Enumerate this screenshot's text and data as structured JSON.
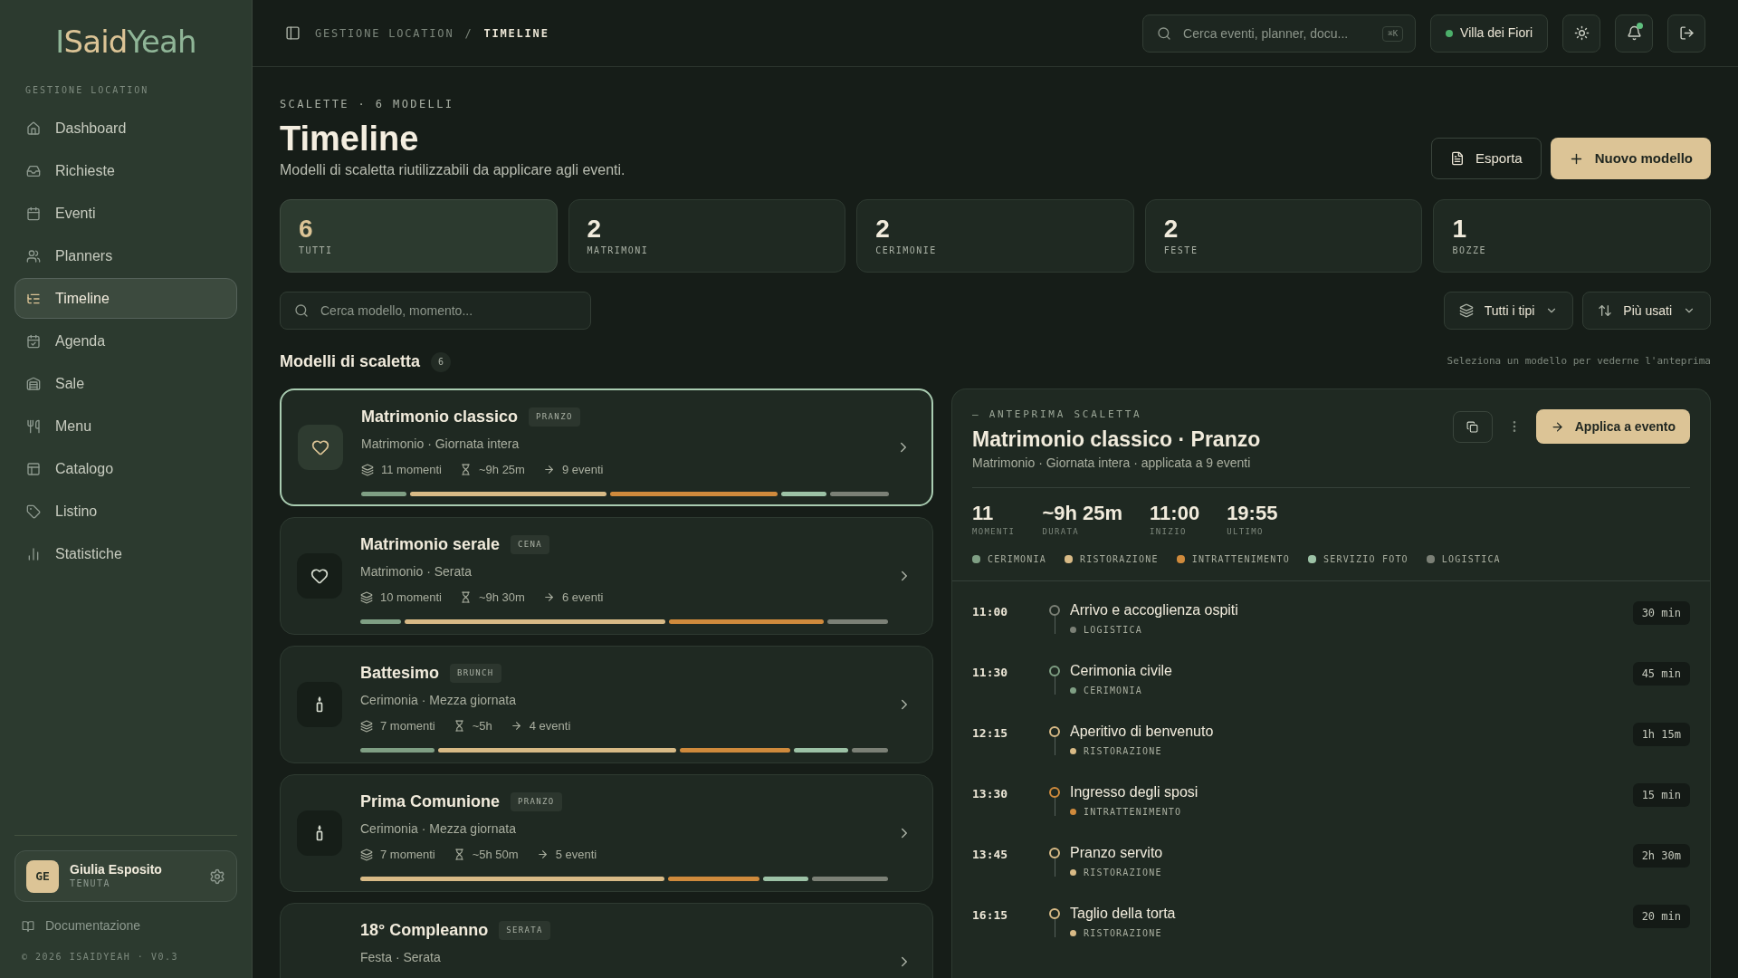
{
  "sidebar": {
    "logo": [
      "I",
      "Said",
      "Yeah"
    ],
    "section_label": "GESTIONE LOCATION",
    "items": [
      {
        "label": "Dashboard",
        "selected": false
      },
      {
        "label": "Richieste",
        "selected": false
      },
      {
        "label": "Eventi",
        "selected": false
      },
      {
        "label": "Planners",
        "selected": false
      },
      {
        "label": "Timeline",
        "selected": true
      },
      {
        "label": "Agenda",
        "selected": false
      },
      {
        "label": "Sale",
        "selected": false
      },
      {
        "label": "Menu",
        "selected": false
      },
      {
        "label": "Catalogo",
        "selected": false
      },
      {
        "label": "Listino",
        "selected": false
      },
      {
        "label": "Statistiche",
        "selected": false
      }
    ],
    "user": {
      "initials": "GE",
      "name": "Giulia Esposito",
      "role": "TENUTA"
    },
    "docs_link": "Documentazione",
    "footer": "© 2026 ISAIDYEAH · V0.3"
  },
  "topbar": {
    "breadcrumb": [
      "GESTIONE LOCATION",
      "/",
      "TIMELINE"
    ],
    "search": {
      "placeholder": "Cerca eventi, planner, docu...",
      "shortcut": "⌘K"
    },
    "location": "Villa dei Fiori",
    "notifications_unread": true
  },
  "header": {
    "eyebrow": "SCALETTE · 6 MODELLI",
    "title": "Timeline",
    "subtitle": "Modelli di scaletta riutilizzabili da applicare agli eventi.",
    "buttons": [
      "Esporta",
      "Nuovo modello"
    ]
  },
  "stats": [
    {
      "value": "6",
      "label": "TUTTI",
      "selected": true
    },
    {
      "value": "2",
      "label": "MATRIMONI",
      "selected": false
    },
    {
      "value": "2",
      "label": "CERIMONIE",
      "selected": false
    },
    {
      "value": "2",
      "label": "FESTE",
      "selected": false
    },
    {
      "value": "1",
      "label": "BOZZE",
      "selected": false
    }
  ],
  "filters": {
    "search": {
      "placeholder": "Cerca modello, momento..."
    },
    "type": "Tutti i tipi",
    "sort": "Più usati"
  },
  "list": {
    "title": "Modelli di scaletta",
    "count": "6",
    "hint": "Seleziona un modello per vederne l'anteprima"
  },
  "cards": [
    {
      "title": "Matrimonio classico",
      "tag": "PRANZO",
      "kind": "wedding",
      "subtitle": "Matrimonio · Giornata intera",
      "moments": "11 momenti",
      "duration": "~9h 25m",
      "events": "9 eventi",
      "selected": true,
      "segments": [
        {
          "color": "#7f9f84"
        },
        {
          "color": "#d8ba86"
        },
        {
          "color": "#cf8a3c"
        },
        {
          "color": "#9cc2a6"
        },
        {
          "color": "#7b8076"
        }
      ]
    },
    {
      "title": "Matrimonio serale",
      "tag": "CENA",
      "kind": "wedding",
      "subtitle": "Matrimonio · Serata",
      "moments": "10 momenti",
      "duration": "~9h 30m",
      "events": "6 eventi",
      "selected": false,
      "segments": [
        {
          "color": "#7f9f84"
        },
        {
          "color": "#d8ba86"
        },
        {
          "color": "#cf8a3c"
        },
        {
          "color": "#7b8076"
        }
      ]
    },
    {
      "title": "Battesimo",
      "tag": "BRUNCH",
      "kind": "ceremony",
      "subtitle": "Cerimonia · Mezza giornata",
      "moments": "7 momenti",
      "duration": "~5h",
      "events": "4 eventi",
      "selected": false,
      "segments": [
        {
          "color": "#7f9f84"
        },
        {
          "color": "#d8ba86"
        },
        {
          "color": "#cf8a3c"
        },
        {
          "color": "#9cc2a6"
        },
        {
          "color": "#7b8076"
        }
      ]
    },
    {
      "title": "Prima Comunione",
      "tag": "PRANZO",
      "kind": "ceremony",
      "subtitle": "Cerimonia · Mezza giornata",
      "moments": "7 momenti",
      "duration": "~5h 50m",
      "events": "5 eventi",
      "selected": false,
      "segments": [
        {
          "color": "#d8ba86"
        },
        {
          "color": "#cf8a3c"
        },
        {
          "color": "#9cc2a6"
        },
        {
          "color": "#7b8076"
        }
      ]
    },
    {
      "title": "18° Compleanno",
      "tag": "SERATA",
      "subtitle": "Festa · Serata",
      "selected": false
    }
  ],
  "preview": {
    "eyebrow": "— ANTEPRIMA SCALETTA",
    "title": "Matrimonio classico · Pranzo",
    "subtitle": "Matrimonio · Giornata intera · applicata a 9 eventi",
    "apply": "Applica a evento",
    "stats": [
      {
        "value": "11",
        "label": "MOMENTI"
      },
      {
        "value": "~9h 25m",
        "label": "DURATA"
      },
      {
        "value": "11:00",
        "label": "INIZIO"
      },
      {
        "value": "19:55",
        "label": "ULTIMO"
      }
    ],
    "legend": [
      {
        "label": "CERIMONIA",
        "color": "#7f9f84"
      },
      {
        "label": "RISTORAZIONE",
        "color": "#d8ba86"
      },
      {
        "label": "INTRATTENIMENTO",
        "color": "#cf8a3c"
      },
      {
        "label": "SERVIZIO FOTO",
        "color": "#9cc2a6"
      },
      {
        "label": "LOGISTICA",
        "color": "#7b8076"
      }
    ],
    "items": [
      {
        "time": "11:00",
        "title": "Arrivo e accoglienza ospiti",
        "category": "LOGISTICA",
        "color": "#7b8076",
        "duration": "30 min"
      },
      {
        "time": "11:30",
        "title": "Cerimonia civile",
        "category": "CERIMONIA",
        "color": "#7f9f84",
        "duration": "45 min"
      },
      {
        "time": "12:15",
        "title": "Aperitivo di benvenuto",
        "category": "RISTORAZIONE",
        "color": "#d8ba86",
        "duration": "1h 15m"
      },
      {
        "time": "13:30",
        "title": "Ingresso degli sposi",
        "category": "INTRATTENIMENTO",
        "color": "#cf8a3c",
        "duration": "15 min"
      },
      {
        "time": "13:45",
        "title": "Pranzo servito",
        "category": "RISTORAZIONE",
        "color": "#d8ba86",
        "duration": "2h 30m"
      },
      {
        "time": "16:15",
        "title": "Taglio della torta",
        "category": "RISTORAZIONE",
        "color": "#d8ba86",
        "duration": "20 min"
      }
    ]
  }
}
